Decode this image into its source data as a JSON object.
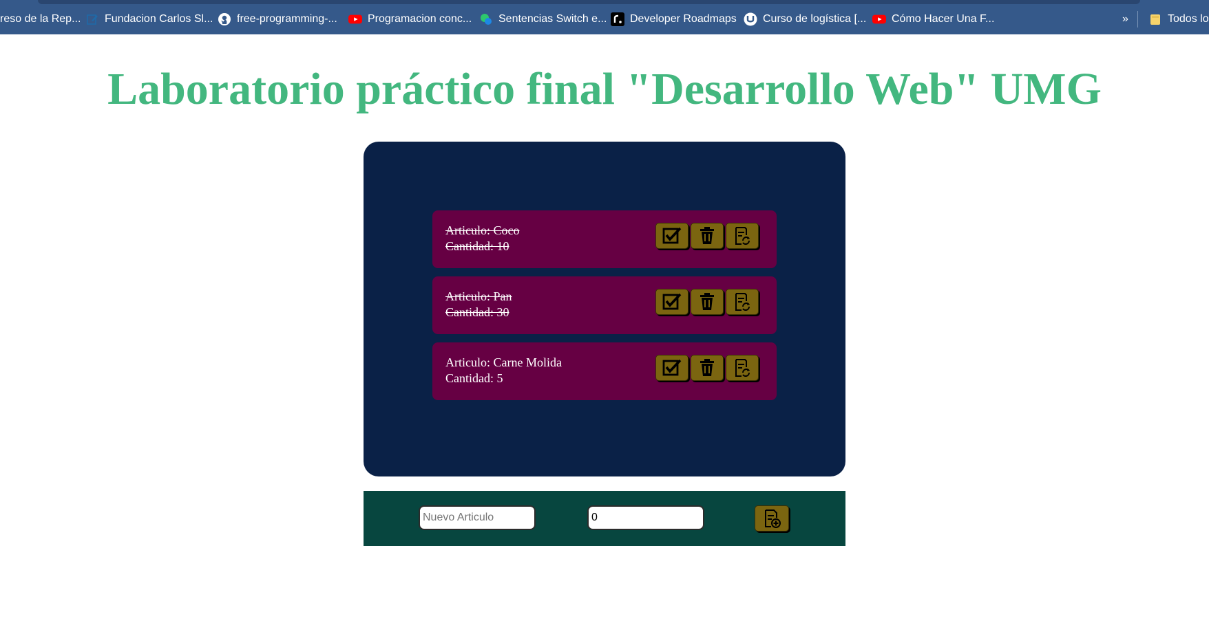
{
  "bookmarks": [
    {
      "label": "reso de la Rep...",
      "icon": "none"
    },
    {
      "label": "Fundacion Carlos Sl...",
      "icon": "edit-icon"
    },
    {
      "label": "free-programming-...",
      "icon": "github-icon"
    },
    {
      "label": "Programacion conc...",
      "icon": "youtube-icon"
    },
    {
      "label": "Sentencias Switch e...",
      "icon": "site-icon"
    },
    {
      "label": "Developer Roadmaps",
      "icon": "roadmap-icon"
    },
    {
      "label": "Curso de logística [...",
      "icon": "udemy-icon"
    },
    {
      "label": "Cómo Hacer Una F...",
      "icon": "youtube-icon"
    },
    {
      "label": "»",
      "icon": "chevron-double-right-icon"
    },
    {
      "label": "Todos los",
      "icon": "folder-icon"
    }
  ],
  "page": {
    "title": "Laboratorio práctico final \"Desarrollo Web\" UMG"
  },
  "items": [
    {
      "article": "Articulo: Coco",
      "quantity": "Cantidad: 10",
      "done": true
    },
    {
      "article": "Articulo: Pan",
      "quantity": "Cantidad: 30",
      "done": true
    },
    {
      "article": "Articulo: Carne Molida",
      "quantity": "Cantidad: 5",
      "done": false
    }
  ],
  "form": {
    "article_placeholder": "Nuevo Articulo",
    "quantity_value": "0"
  },
  "colors": {
    "title": "#43b77f",
    "panel": "#0a2147",
    "item": "#660043",
    "button": "#7b6510",
    "form_bar": "#07463f",
    "bookmarks_bar": "#35598a"
  }
}
